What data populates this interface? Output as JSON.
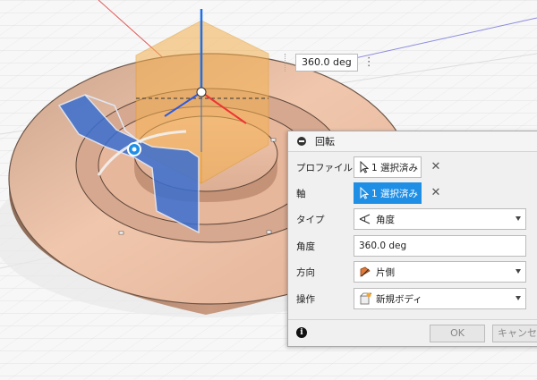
{
  "viewport": {
    "float_value": "360.0 deg"
  },
  "dialog": {
    "title": "回転",
    "rows": {
      "profile": {
        "label": "プロファイル",
        "button": "1 選択済み"
      },
      "axis": {
        "label": "軸",
        "button": "1 選択済み"
      },
      "type": {
        "label": "タイプ",
        "value": "角度"
      },
      "angle": {
        "label": "角度",
        "value": "360.0 deg"
      },
      "direction": {
        "label": "方向",
        "value": "片側"
      },
      "operation": {
        "label": "操作",
        "value": "新規ボディ"
      }
    },
    "footer": {
      "ok": "OK",
      "cancel": "キャンセル"
    }
  },
  "colors": {
    "accent": "#1f8fe6",
    "part": "#d9a98e",
    "plane": "#f4b04f",
    "manipulator": "#3a6fd0"
  },
  "icons": {
    "profile_select": "cursor-arrow-icon",
    "axis_select": "cursor-arrow-icon",
    "type": "angle-icon",
    "direction": "one-side-icon",
    "operation": "new-body-icon",
    "info": "info-icon",
    "collapse": "collapse-minus-icon",
    "remove": "close-icon"
  }
}
